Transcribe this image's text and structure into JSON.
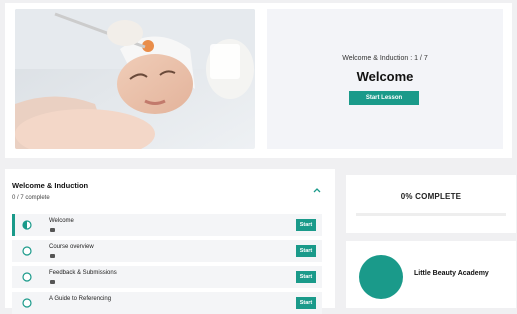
{
  "hero": {
    "lesson_counter": "Welcome & Induction : 1 / 7",
    "lesson_title": "Welcome",
    "start_button_label": "Start Lesson"
  },
  "module": {
    "title": "Welcome & Induction",
    "progress_text": "0 / 7 complete",
    "lessons": [
      {
        "title": "Welcome",
        "start_label": "Start",
        "status": "in-progress"
      },
      {
        "title": "Course overview",
        "start_label": "Start",
        "status": "not-started"
      },
      {
        "title": "Feedback & Submissions",
        "start_label": "Start",
        "status": "not-started"
      },
      {
        "title": "A Guide to Referencing",
        "start_label": "Start",
        "status": "not-started"
      }
    ]
  },
  "course_progress": {
    "label": "0% COMPLETE",
    "percent": 0
  },
  "academy": {
    "name": "Little Beauty Academy"
  },
  "colors": {
    "accent": "#1a9a8a",
    "page_background": "#f0f0f2",
    "panel_background": "#f3f4f8"
  },
  "icons": {
    "row_in_progress": "half-circle-icon",
    "row_not_started": "empty-circle-icon",
    "lesson_type": "document-icon",
    "collapse": "chevron-up-icon"
  }
}
